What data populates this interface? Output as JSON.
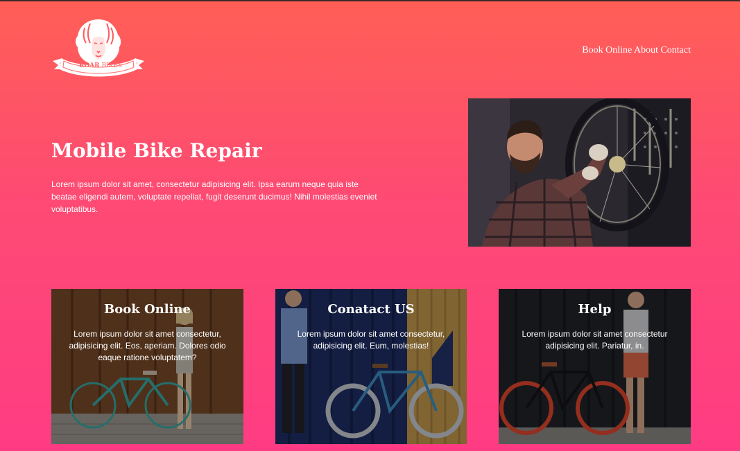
{
  "logo": {
    "text_roar": "ROAR",
    "text_bikes": "BIKES",
    "icon": "lion-head"
  },
  "nav": {
    "items": [
      {
        "label": "Book Online"
      },
      {
        "label": "About"
      },
      {
        "label": "Contact"
      }
    ]
  },
  "hero": {
    "title": "Mobile Bike Repair",
    "text": "Lorem ipsum dolor sit amet, consectetur adipisicing elit. Ipsa earum neque quia iste beatae eligendi autem, voluptate repellat, fugit deserunt ducimus! Nihil molestias eveniet voluptatibus.",
    "image": "mechanic-repairing-bike-wheel"
  },
  "cards": [
    {
      "title": "Book Online",
      "text": "Lorem ipsum dolor sit amet consectetur, adipisicing elit. Eos, aperiam. Dolores odio eaque ratione voluptatem?",
      "image": "woman-with-teal-bicycle"
    },
    {
      "title": "Conatact US",
      "text": "Lorem ipsum dolor sit amet consectetur, adipisicing elit. Eum, molestias!",
      "image": "man-with-blue-fixie"
    },
    {
      "title": "Help",
      "text": "Lorem ipsum dolor sit amet consectetur adipisicing elit. Pariatur, in.",
      "image": "man-with-red-rim-bicycle"
    }
  ],
  "colors": {
    "gradient_top": "#ff5f56",
    "gradient_bottom": "#ff3c83",
    "text": "#ffffff"
  }
}
